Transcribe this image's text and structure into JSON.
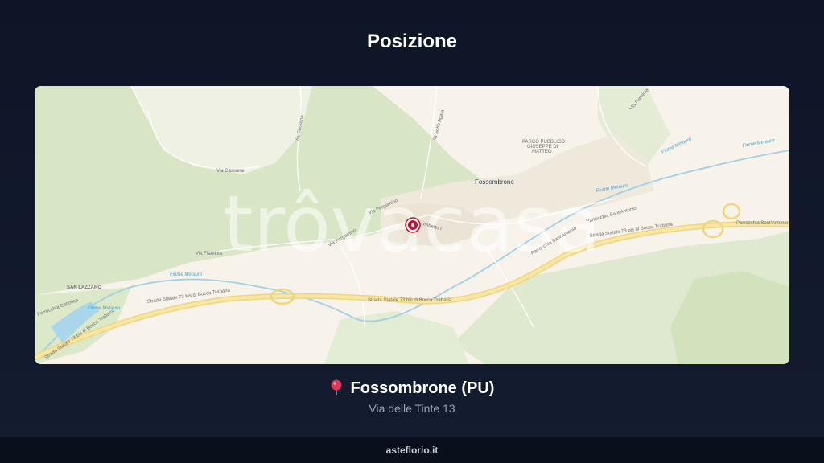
{
  "title": "Posizione",
  "map": {
    "watermark": "trôvacasa",
    "labels": {
      "city_center": "Fossombrone",
      "san_lazzaro": "SAN LAZZARO",
      "parco": "PARCO PUBBLICO",
      "parco2": "GIUSEPPE DI",
      "parco3": "MATTEO",
      "via_cassana": "Via Cassana",
      "via_cassana2": "Via Cassana",
      "via_pergamino": "Via Pergamino",
      "via_pergamino2": "Via Pergamino",
      "via_flaminia": "Via Flaminia",
      "via_umberto": "Via Umberto I",
      "via_flaminia_ne": "Via Flaminia",
      "strada_statale_1": "Strada Statale 73 bis di Bocca Trabaria",
      "strada_statale_2": "Strada Statale 73 bis di Bocca Trabaria",
      "strada_statale_3": "Strada Statale 73 bis di Bocca Trabaria",
      "strada_statale_4": "Strada Statale 73 bis di Bocca Trabaria",
      "parrocchia_sant_antonio": "Parrocchia Sant'Antonio",
      "parrocchia_sant_antonio2": "Parrocchia Sant'Antonio",
      "parrocchia_sant_antonio3": "Parrocchia Sant'Antonio",
      "parrocchia_cattolica": "Parrocchia Cattolica",
      "fiume_metauro": "Fiume Metauro",
      "fiume_metauro2": "Fiume Metauro",
      "fiume_metauro3": "Fiume Metauro",
      "fiume_metauro4": "Fiume Metauro",
      "fiume_metauro5": "Fiume Metauro",
      "via_santa_agata": "Via Sotto Agata"
    },
    "colors": {
      "background": "#f7f3ea",
      "forest": "#d9e8c8",
      "road_major": "#f5dc8a",
      "river": "#9fd0e6",
      "marker": "#c8102e"
    }
  },
  "location": {
    "city": "Fossombrone (PU)",
    "address": "Via delle Tinte 13",
    "pin_icon": "round-pushpin"
  },
  "footer": {
    "site": "asteflorio.it"
  }
}
